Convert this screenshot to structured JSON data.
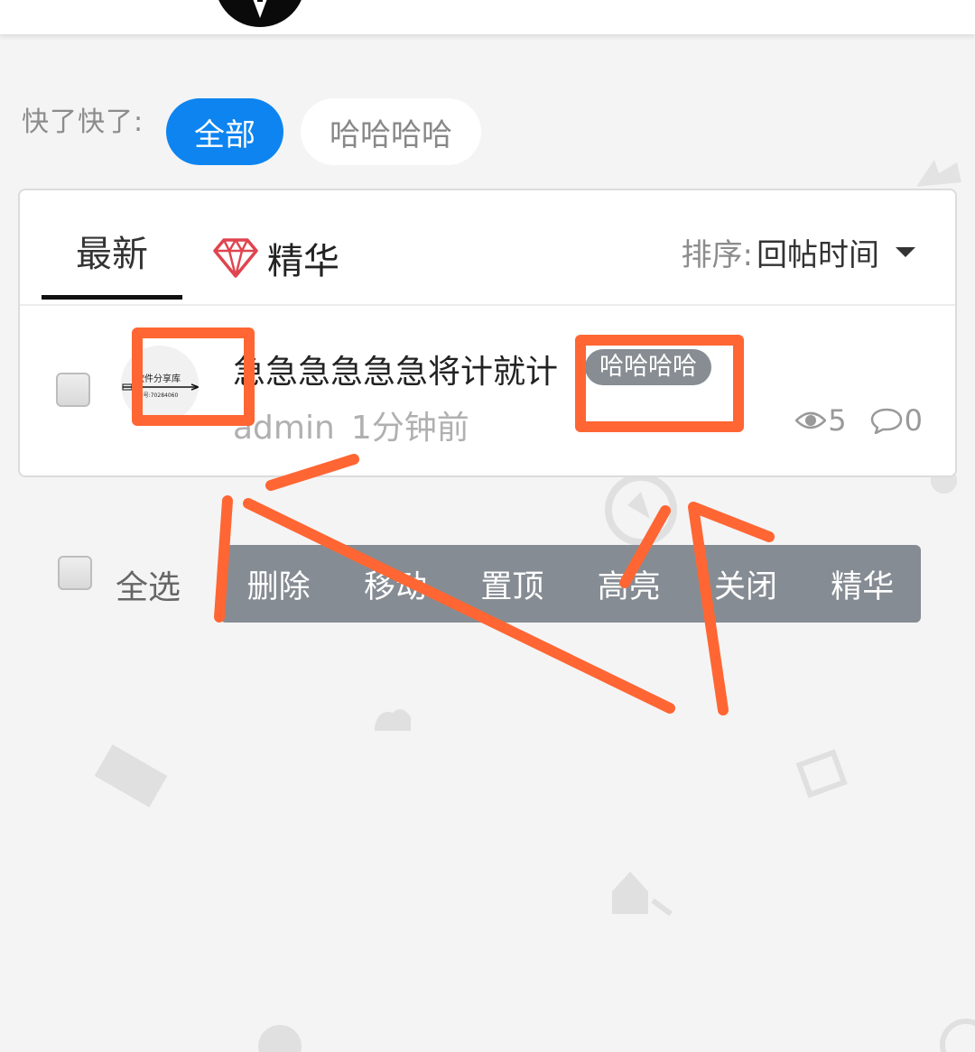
{
  "header": {
    "logo_icon": "circle-logo-icon"
  },
  "filter": {
    "label": "快了快了:",
    "options": [
      {
        "label": "全部",
        "active": true
      },
      {
        "label": "哈哈哈哈",
        "active": false
      }
    ]
  },
  "tabs": {
    "latest": "最新",
    "essence": "精华",
    "essence_icon": "diamond-icon",
    "sort_label": "排序:",
    "sort_value": "回帖时间"
  },
  "post": {
    "avatar_line1": "软件分享库",
    "avatar_line2": "Q群号:70284060",
    "title": "急急急急急急将计就计",
    "tag": "哈哈哈哈",
    "author": "admin",
    "time": "1分钟前",
    "views": "5",
    "comments": "0"
  },
  "bulk": {
    "select_all": "全选",
    "actions": [
      "删除",
      "移动",
      "置顶",
      "高亮",
      "关闭",
      "精华"
    ]
  },
  "colors": {
    "primary": "#0d84f0",
    "action_bar": "#868c93",
    "annotation": "#ff6633",
    "gem": "#e0444e"
  }
}
